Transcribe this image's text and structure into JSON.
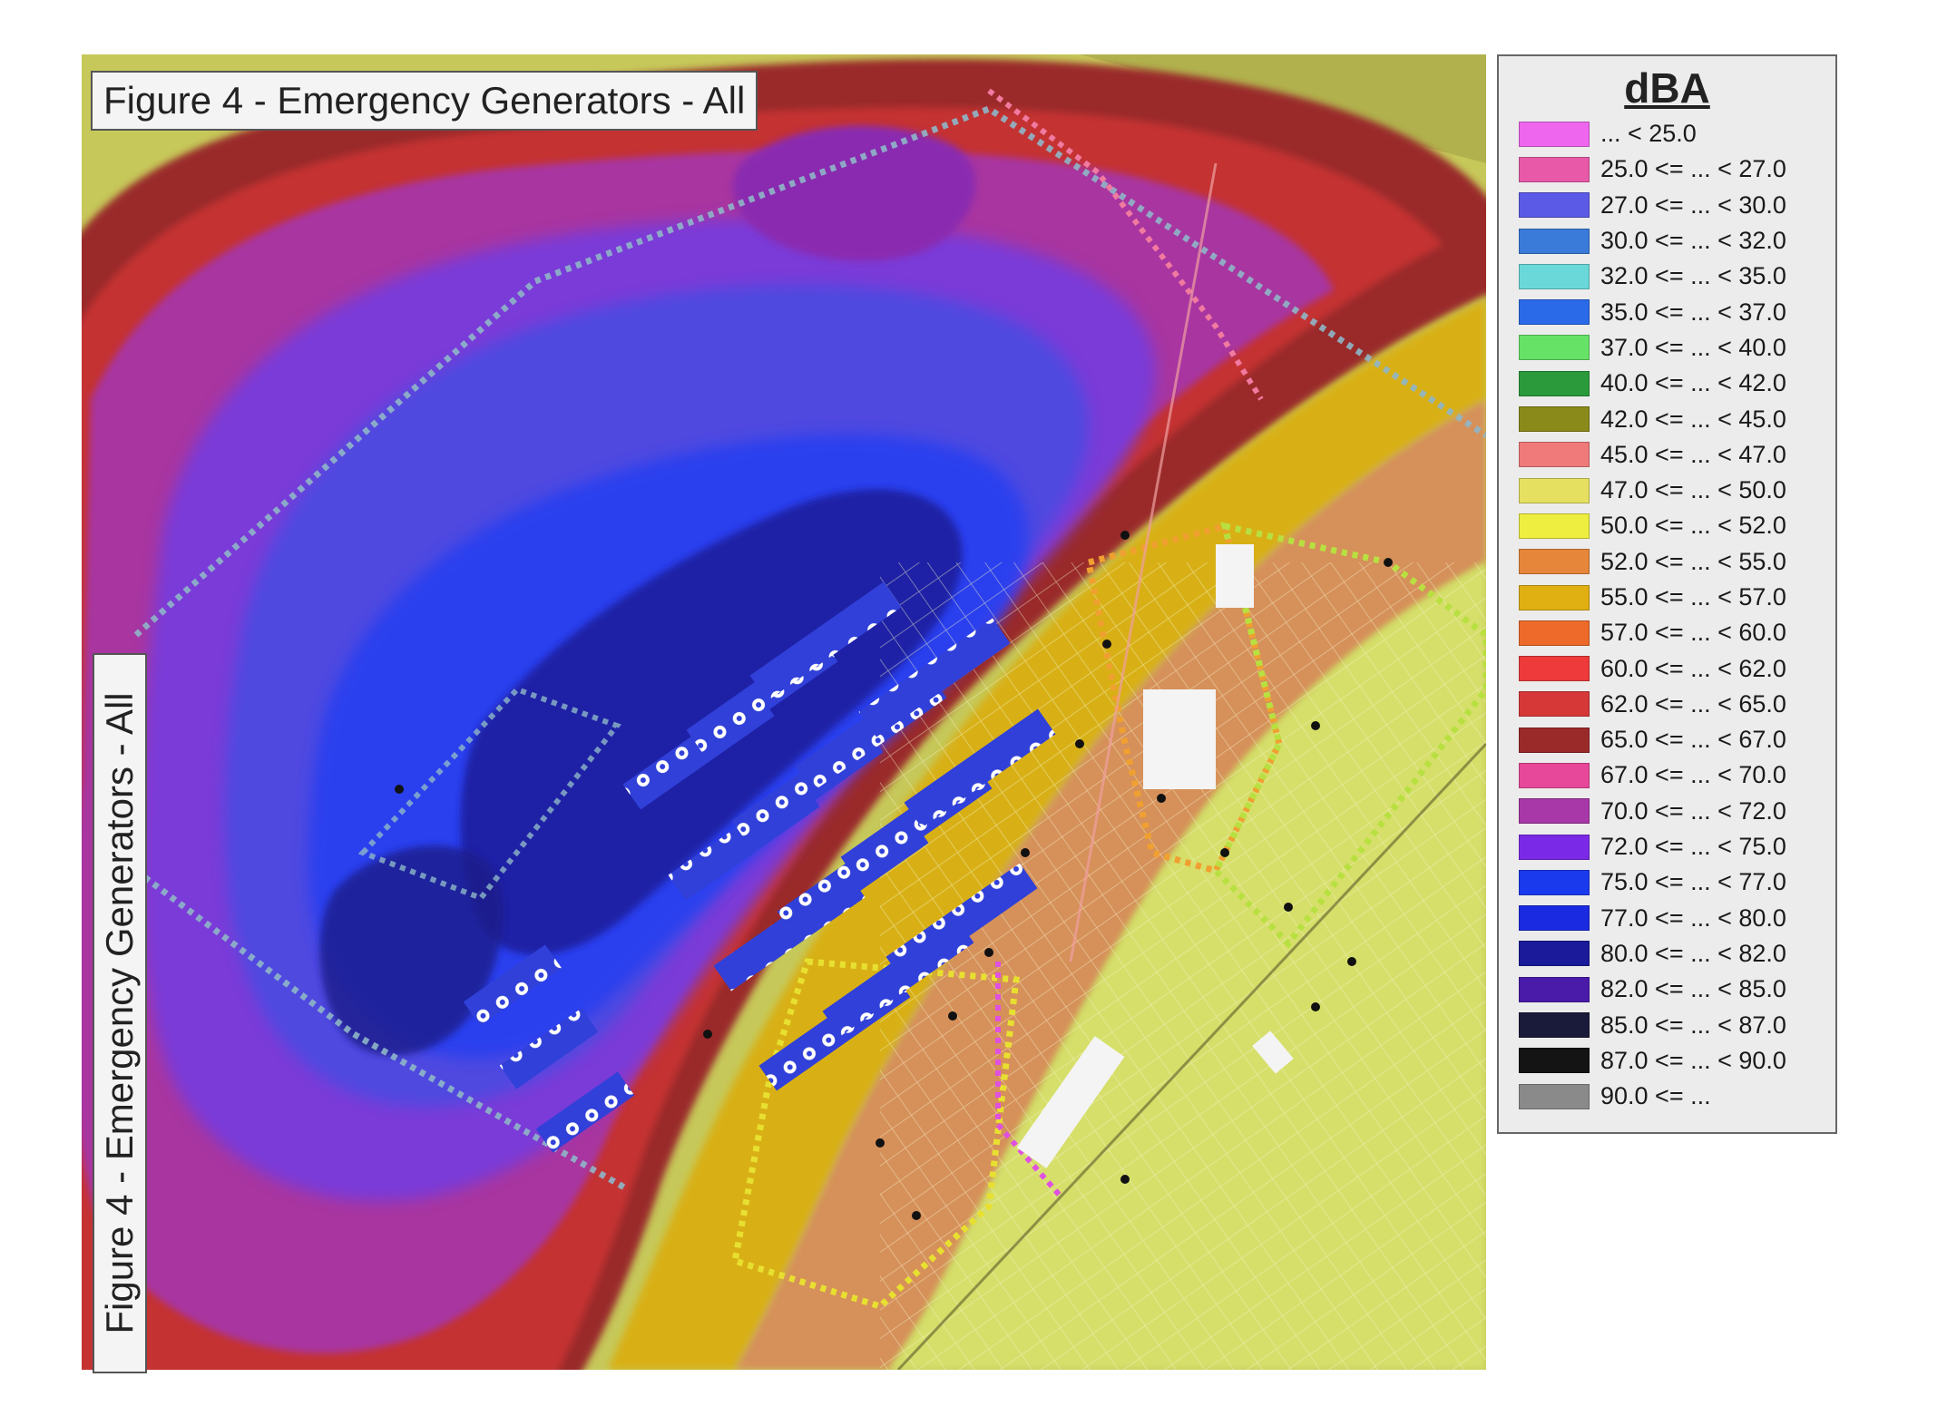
{
  "figure": {
    "title": "Figure 4 - Emergency Generators - All",
    "title_vertical": "Figure 4 - Emergency Generators - All"
  },
  "legend": {
    "title": "dBA",
    "items": [
      {
        "label": "... < 25.0",
        "color": "#ee66ee"
      },
      {
        "label": "25.0 <= ... < 27.0",
        "color": "#e85aa8"
      },
      {
        "label": "27.0 <= ... < 30.0",
        "color": "#5a5ae6"
      },
      {
        "label": "30.0 <= ... < 32.0",
        "color": "#3a7ad8"
      },
      {
        "label": "32.0 <= ... < 35.0",
        "color": "#6ad8d8"
      },
      {
        "label": "35.0 <= ... < 37.0",
        "color": "#2a6ae8"
      },
      {
        "label": "37.0 <= ... < 40.0",
        "color": "#66e266"
      },
      {
        "label": "40.0 <= ... < 42.0",
        "color": "#2a9a3a"
      },
      {
        "label": "42.0 <= ... < 45.0",
        "color": "#8a8a1a"
      },
      {
        "label": "45.0 <= ... < 47.0",
        "color": "#f07a7a"
      },
      {
        "label": "47.0 <= ... < 50.0",
        "color": "#e6e060"
      },
      {
        "label": "50.0 <= ... < 52.0",
        "color": "#eeee40"
      },
      {
        "label": "52.0 <= ... < 55.0",
        "color": "#e6863a"
      },
      {
        "label": "55.0 <= ... < 57.0",
        "color": "#e0b012"
      },
      {
        "label": "57.0 <= ... < 60.0",
        "color": "#ee6a2a"
      },
      {
        "label": "60.0 <= ... < 62.0",
        "color": "#ee3a3a"
      },
      {
        "label": "62.0 <= ... < 65.0",
        "color": "#d63838"
      },
      {
        "label": "65.0 <= ... < 67.0",
        "color": "#9a2a2a"
      },
      {
        "label": "67.0 <= ... < 70.0",
        "color": "#e8489a"
      },
      {
        "label": "70.0 <= ... < 72.0",
        "color": "#a838a8"
      },
      {
        "label": "72.0 <= ... < 75.0",
        "color": "#7a2ae6"
      },
      {
        "label": "75.0 <= ... < 77.0",
        "color": "#1a3aee"
      },
      {
        "label": "77.0 <= ... < 80.0",
        "color": "#1a2ae0"
      },
      {
        "label": "80.0 <= ... < 82.0",
        "color": "#1a1a9a"
      },
      {
        "label": "82.0 <= ... < 85.0",
        "color": "#4a1aa8"
      },
      {
        "label": "85.0 <= ... < 87.0",
        "color": "#1a1a3a"
      },
      {
        "label": "87.0 <= ... < 90.0",
        "color": "#141414"
      },
      {
        "label": "90.0 <= ...",
        "color": "#8a8a8a"
      }
    ]
  }
}
